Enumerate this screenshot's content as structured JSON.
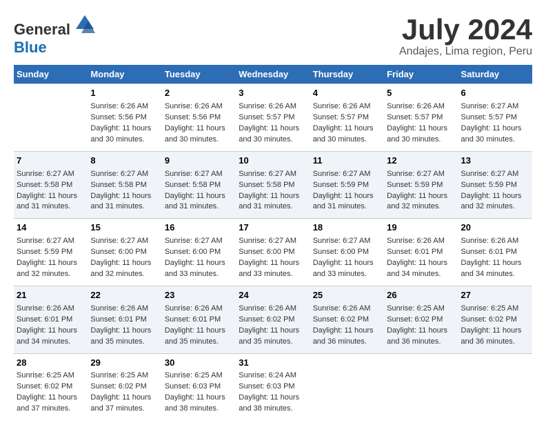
{
  "logo": {
    "text_general": "General",
    "text_blue": "Blue"
  },
  "title": "July 2024",
  "subtitle": "Andajes, Lima region, Peru",
  "header_days": [
    "Sunday",
    "Monday",
    "Tuesday",
    "Wednesday",
    "Thursday",
    "Friday",
    "Saturday"
  ],
  "weeks": [
    [
      {
        "day": "",
        "sunrise": "",
        "sunset": "",
        "daylight": ""
      },
      {
        "day": "1",
        "sunrise": "Sunrise: 6:26 AM",
        "sunset": "Sunset: 5:56 PM",
        "daylight": "Daylight: 11 hours and 30 minutes."
      },
      {
        "day": "2",
        "sunrise": "Sunrise: 6:26 AM",
        "sunset": "Sunset: 5:56 PM",
        "daylight": "Daylight: 11 hours and 30 minutes."
      },
      {
        "day": "3",
        "sunrise": "Sunrise: 6:26 AM",
        "sunset": "Sunset: 5:57 PM",
        "daylight": "Daylight: 11 hours and 30 minutes."
      },
      {
        "day": "4",
        "sunrise": "Sunrise: 6:26 AM",
        "sunset": "Sunset: 5:57 PM",
        "daylight": "Daylight: 11 hours and 30 minutes."
      },
      {
        "day": "5",
        "sunrise": "Sunrise: 6:26 AM",
        "sunset": "Sunset: 5:57 PM",
        "daylight": "Daylight: 11 hours and 30 minutes."
      },
      {
        "day": "6",
        "sunrise": "Sunrise: 6:27 AM",
        "sunset": "Sunset: 5:57 PM",
        "daylight": "Daylight: 11 hours and 30 minutes."
      }
    ],
    [
      {
        "day": "7",
        "sunrise": "Sunrise: 6:27 AM",
        "sunset": "Sunset: 5:58 PM",
        "daylight": "Daylight: 11 hours and 31 minutes."
      },
      {
        "day": "8",
        "sunrise": "Sunrise: 6:27 AM",
        "sunset": "Sunset: 5:58 PM",
        "daylight": "Daylight: 11 hours and 31 minutes."
      },
      {
        "day": "9",
        "sunrise": "Sunrise: 6:27 AM",
        "sunset": "Sunset: 5:58 PM",
        "daylight": "Daylight: 11 hours and 31 minutes."
      },
      {
        "day": "10",
        "sunrise": "Sunrise: 6:27 AM",
        "sunset": "Sunset: 5:58 PM",
        "daylight": "Daylight: 11 hours and 31 minutes."
      },
      {
        "day": "11",
        "sunrise": "Sunrise: 6:27 AM",
        "sunset": "Sunset: 5:59 PM",
        "daylight": "Daylight: 11 hours and 31 minutes."
      },
      {
        "day": "12",
        "sunrise": "Sunrise: 6:27 AM",
        "sunset": "Sunset: 5:59 PM",
        "daylight": "Daylight: 11 hours and 32 minutes."
      },
      {
        "day": "13",
        "sunrise": "Sunrise: 6:27 AM",
        "sunset": "Sunset: 5:59 PM",
        "daylight": "Daylight: 11 hours and 32 minutes."
      }
    ],
    [
      {
        "day": "14",
        "sunrise": "Sunrise: 6:27 AM",
        "sunset": "Sunset: 5:59 PM",
        "daylight": "Daylight: 11 hours and 32 minutes."
      },
      {
        "day": "15",
        "sunrise": "Sunrise: 6:27 AM",
        "sunset": "Sunset: 6:00 PM",
        "daylight": "Daylight: 11 hours and 32 minutes."
      },
      {
        "day": "16",
        "sunrise": "Sunrise: 6:27 AM",
        "sunset": "Sunset: 6:00 PM",
        "daylight": "Daylight: 11 hours and 33 minutes."
      },
      {
        "day": "17",
        "sunrise": "Sunrise: 6:27 AM",
        "sunset": "Sunset: 6:00 PM",
        "daylight": "Daylight: 11 hours and 33 minutes."
      },
      {
        "day": "18",
        "sunrise": "Sunrise: 6:27 AM",
        "sunset": "Sunset: 6:00 PM",
        "daylight": "Daylight: 11 hours and 33 minutes."
      },
      {
        "day": "19",
        "sunrise": "Sunrise: 6:26 AM",
        "sunset": "Sunset: 6:01 PM",
        "daylight": "Daylight: 11 hours and 34 minutes."
      },
      {
        "day": "20",
        "sunrise": "Sunrise: 6:26 AM",
        "sunset": "Sunset: 6:01 PM",
        "daylight": "Daylight: 11 hours and 34 minutes."
      }
    ],
    [
      {
        "day": "21",
        "sunrise": "Sunrise: 6:26 AM",
        "sunset": "Sunset: 6:01 PM",
        "daylight": "Daylight: 11 hours and 34 minutes."
      },
      {
        "day": "22",
        "sunrise": "Sunrise: 6:26 AM",
        "sunset": "Sunset: 6:01 PM",
        "daylight": "Daylight: 11 hours and 35 minutes."
      },
      {
        "day": "23",
        "sunrise": "Sunrise: 6:26 AM",
        "sunset": "Sunset: 6:01 PM",
        "daylight": "Daylight: 11 hours and 35 minutes."
      },
      {
        "day": "24",
        "sunrise": "Sunrise: 6:26 AM",
        "sunset": "Sunset: 6:02 PM",
        "daylight": "Daylight: 11 hours and 35 minutes."
      },
      {
        "day": "25",
        "sunrise": "Sunrise: 6:26 AM",
        "sunset": "Sunset: 6:02 PM",
        "daylight": "Daylight: 11 hours and 36 minutes."
      },
      {
        "day": "26",
        "sunrise": "Sunrise: 6:25 AM",
        "sunset": "Sunset: 6:02 PM",
        "daylight": "Daylight: 11 hours and 36 minutes."
      },
      {
        "day": "27",
        "sunrise": "Sunrise: 6:25 AM",
        "sunset": "Sunset: 6:02 PM",
        "daylight": "Daylight: 11 hours and 36 minutes."
      }
    ],
    [
      {
        "day": "28",
        "sunrise": "Sunrise: 6:25 AM",
        "sunset": "Sunset: 6:02 PM",
        "daylight": "Daylight: 11 hours and 37 minutes."
      },
      {
        "day": "29",
        "sunrise": "Sunrise: 6:25 AM",
        "sunset": "Sunset: 6:02 PM",
        "daylight": "Daylight: 11 hours and 37 minutes."
      },
      {
        "day": "30",
        "sunrise": "Sunrise: 6:25 AM",
        "sunset": "Sunset: 6:03 PM",
        "daylight": "Daylight: 11 hours and 38 minutes."
      },
      {
        "day": "31",
        "sunrise": "Sunrise: 6:24 AM",
        "sunset": "Sunset: 6:03 PM",
        "daylight": "Daylight: 11 hours and 38 minutes."
      },
      {
        "day": "",
        "sunrise": "",
        "sunset": "",
        "daylight": ""
      },
      {
        "day": "",
        "sunrise": "",
        "sunset": "",
        "daylight": ""
      },
      {
        "day": "",
        "sunrise": "",
        "sunset": "",
        "daylight": ""
      }
    ]
  ]
}
